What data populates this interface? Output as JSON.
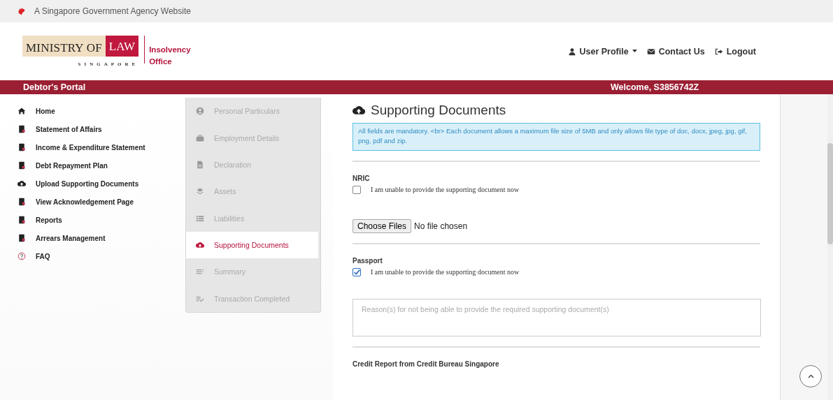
{
  "masthead": {
    "text": "A Singapore Government Agency Website"
  },
  "logo": {
    "ministry": "MINISTRY OF",
    "law": "LAW",
    "country": "SINGAPORE",
    "office_line_1": "Insolvency",
    "office_line_2": "Office"
  },
  "header_links": [
    {
      "label": "User Profile",
      "kind": "profile"
    },
    {
      "label": "Contact Us",
      "kind": "mail"
    },
    {
      "label": "Logout",
      "kind": "logout"
    }
  ],
  "portal_bar": {
    "title": "Debtor's Portal",
    "welcome": "Welcome, S3856742Z"
  },
  "sidebar": {
    "items": [
      {
        "label": "Home",
        "kind": "home"
      },
      {
        "label": "Statement of Affairs",
        "kind": "doc"
      },
      {
        "label": "Income & Expenditure Statement",
        "kind": "doc"
      },
      {
        "label": "Debt Repayment Plan",
        "kind": "doc"
      },
      {
        "label": "Upload Supporting Documents",
        "kind": "upload"
      },
      {
        "label": "View Acknowledgement Page",
        "kind": "doc"
      },
      {
        "label": "Reports",
        "kind": "doc"
      },
      {
        "label": "Arrears Management",
        "kind": "doc"
      },
      {
        "label": "FAQ",
        "kind": "help"
      }
    ]
  },
  "steps": [
    {
      "label": "Personal Particulars",
      "kind": "user",
      "selected": false
    },
    {
      "label": "Employment Details",
      "kind": "briefcase",
      "selected": false
    },
    {
      "label": "Declaration",
      "kind": "file",
      "selected": false
    },
    {
      "label": "Assets",
      "kind": "layers",
      "selected": false
    },
    {
      "label": "Liabilities",
      "kind": "list",
      "selected": false
    },
    {
      "label": "Supporting Documents",
      "kind": "upload",
      "selected": true
    },
    {
      "label": "Summary",
      "kind": "lines",
      "selected": false
    },
    {
      "label": "Transaction Completed",
      "kind": "check",
      "selected": false
    }
  ],
  "main": {
    "title": "Supporting Documents",
    "notice": "All fields are mandatory. <br> Each document allows a maximum file size of 5MB and only allows file type of doc, docx, jpeg, jpg, gif, png, pdf and zip.",
    "documents": [
      {
        "name": "NRIC",
        "unable_label": "I am unable to provide the supporting document now",
        "unable_checked": false,
        "choose_button": "Choose Files",
        "file_status": "No file chosen"
      },
      {
        "name": "Passport",
        "unable_label": "I am unable to provide the supporting document now",
        "unable_checked": true,
        "reason_placeholder": "Reason(s) for not being able to provide the required supporting document(s)"
      },
      {
        "name": "Credit Report from Credit Bureau Singapore"
      }
    ]
  }
}
